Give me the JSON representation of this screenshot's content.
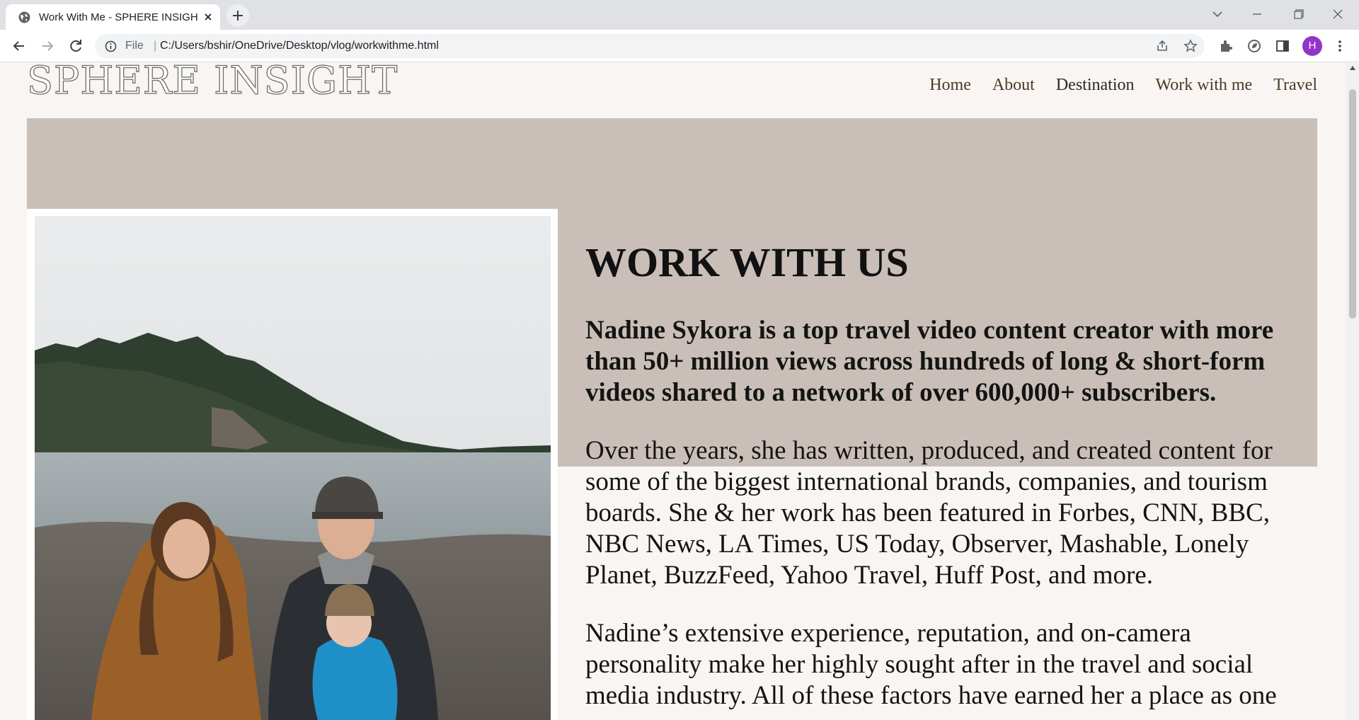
{
  "browser": {
    "tab_title": "Work With Me - SPHERE INSIGHT",
    "omnibox_scheme": "File",
    "url": "C:/Users/bshir/OneDrive/Desktop/vlog/workwithme.html",
    "profile_initial": "H"
  },
  "site": {
    "logo": "SPHERE INSIGHT",
    "nav": [
      "Home",
      "About",
      "Destination",
      "Work with me",
      "Travel"
    ],
    "active_nav": "Destination"
  },
  "content": {
    "heading": "WORK WITH US",
    "lead": "Nadine Sykora is a top travel video content creator with more than 50+ million views across hundreds of long & short-form videos shared to a network of over 600,000+ subscribers.",
    "para1": "Over the years, she has written, produced, and created content for some of the biggest international brands, companies, and tourism boards. She & her work has been featured in Forbes, CNN, BBC, NBC News, LA Times, US Today, Observer, Mashable, Lonely Planet, BuzzFeed, Yahoo Travel, Huff Post, and more.",
    "para2": "Nadine’s extensive experience, reputation, and on-camera personality make her highly sought after in the travel and social media industry. All of these factors have earned her a place as one"
  },
  "colors": {
    "page_bg": "#f8f5f2",
    "hero_band": "#c9bfb8",
    "nav_text": "#4b3a26",
    "avatar": "#9334c9"
  },
  "icons": {
    "tab_favicon": "globe-icon",
    "photo": "family-beach-photo"
  }
}
